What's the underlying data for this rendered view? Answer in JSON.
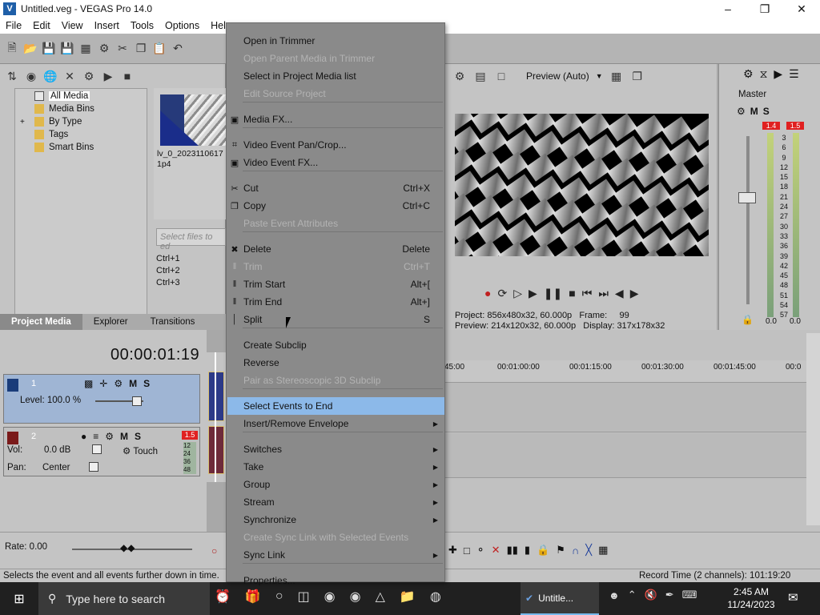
{
  "window": {
    "title": "Untitled.veg - VEGAS Pro 14.0",
    "app_icon": "vegas-icon"
  },
  "menubar": [
    "File",
    "Edit",
    "View",
    "Insert",
    "Tools",
    "Options",
    "Help"
  ],
  "project_media": {
    "tree": [
      {
        "label": "All Media",
        "selected": true
      },
      {
        "label": "Media Bins"
      },
      {
        "label": "By Type",
        "expand": "+"
      },
      {
        "label": "Tags"
      },
      {
        "label": "Smart Bins"
      }
    ],
    "clip_name": "lv_0_20231106171p4",
    "search_placeholder": "Select files to ed",
    "shortcuts": [
      "Ctrl+1",
      "Ctrl+2",
      "Ctrl+3"
    ],
    "tabs": [
      "Project Media",
      "Explorer",
      "Transitions"
    ]
  },
  "preview": {
    "mode": "Preview (Auto)",
    "project_label": "Project:",
    "project_value": "856x480x32, 60.000p",
    "preview_label": "Preview:",
    "preview_value": "214x120x32, 60.000p",
    "frame_label": "Frame:",
    "frame_value": "99",
    "display_label": "Display:",
    "display_value": "317x178x32"
  },
  "master": {
    "title": "Master",
    "peak_left": "1.4",
    "peak_right": "1.5",
    "scale": [
      "3",
      "6",
      "9",
      "12",
      "15",
      "18",
      "21",
      "24",
      "27",
      "30",
      "33",
      "36",
      "39",
      "42",
      "45",
      "48",
      "51",
      "54",
      "57"
    ],
    "level_left": "0.0",
    "level_right": "0.0"
  },
  "timeline": {
    "timecode": "00:00:01:19",
    "track1": {
      "number": "1",
      "level": "Level: 100.0 %",
      "m": "M",
      "s": "S"
    },
    "track2": {
      "number": "2",
      "vol_label": "Vol:",
      "vol": "0.0 dB",
      "pan_label": "Pan:",
      "pan": "Center",
      "touch": "Touch",
      "peak": "1.5",
      "m": "M",
      "s": "S",
      "meter_scale": [
        "12",
        "24",
        "36",
        "48"
      ]
    },
    "ruler": [
      "45:00",
      "00:01:00:00",
      "00:01:15:00",
      "00:01:30:00",
      "00:01:45:00",
      "00:0"
    ],
    "rate": "Rate: 0.00"
  },
  "status": {
    "hint": "Selects the event and all events further down in time.",
    "record_time": "Record Time (2 channels): 101:19:20"
  },
  "taskbar": {
    "search_placeholder": "Type here to search",
    "app_label": "Untitle...",
    "time": "2:45 AM",
    "date": "11/24/2023"
  },
  "menu": {
    "items": [
      {
        "label": "Open in Trimmer"
      },
      {
        "label": "Open Parent Media in Trimmer",
        "disabled": true
      },
      {
        "label": "Select in Project Media list"
      },
      {
        "label": "Edit Source Project",
        "disabled": true
      },
      {
        "label": "Media FX...",
        "icon": "fx-icon"
      },
      {
        "label": "Video Event Pan/Crop...",
        "icon": "crop-icon"
      },
      {
        "label": "Video Event FX...",
        "icon": "fx-icon"
      },
      {
        "label": "Cut",
        "shortcut": "Ctrl+X",
        "icon": "scissors-icon"
      },
      {
        "label": "Copy",
        "shortcut": "Ctrl+C",
        "icon": "copy-icon"
      },
      {
        "label": "Paste Event Attributes",
        "disabled": true
      },
      {
        "label": "Delete",
        "shortcut": "Delete",
        "icon": "delete-icon"
      },
      {
        "label": "Trim",
        "shortcut": "Ctrl+T",
        "disabled": true,
        "icon": "trim-icon"
      },
      {
        "label": "Trim Start",
        "shortcut": "Alt+[",
        "icon": "trim-start-icon"
      },
      {
        "label": "Trim End",
        "shortcut": "Alt+]",
        "icon": "trim-end-icon"
      },
      {
        "label": "Split",
        "shortcut": "S",
        "icon": "split-icon"
      },
      {
        "label": "Create Subclip"
      },
      {
        "label": "Reverse"
      },
      {
        "label": "Pair as Stereoscopic 3D Subclip",
        "disabled": true
      },
      {
        "label": "Select Events to End",
        "highlighted": true
      },
      {
        "label": "Insert/Remove Envelope",
        "submenu": true
      },
      {
        "label": "Switches",
        "submenu": true
      },
      {
        "label": "Take",
        "submenu": true
      },
      {
        "label": "Group",
        "submenu": true
      },
      {
        "label": "Stream",
        "submenu": true
      },
      {
        "label": "Synchronize",
        "submenu": true
      },
      {
        "label": "Create Sync Link with Selected Events",
        "disabled": true
      },
      {
        "label": "Sync Link",
        "submenu": true
      },
      {
        "label": "Properties..."
      }
    ]
  },
  "colors": {
    "highlight": "#8cb9e9",
    "menu_bg": "#8a8a8a",
    "taskbar": "#202020",
    "peak_red": "#e02020",
    "track1_bg": "#9fb5d4"
  }
}
